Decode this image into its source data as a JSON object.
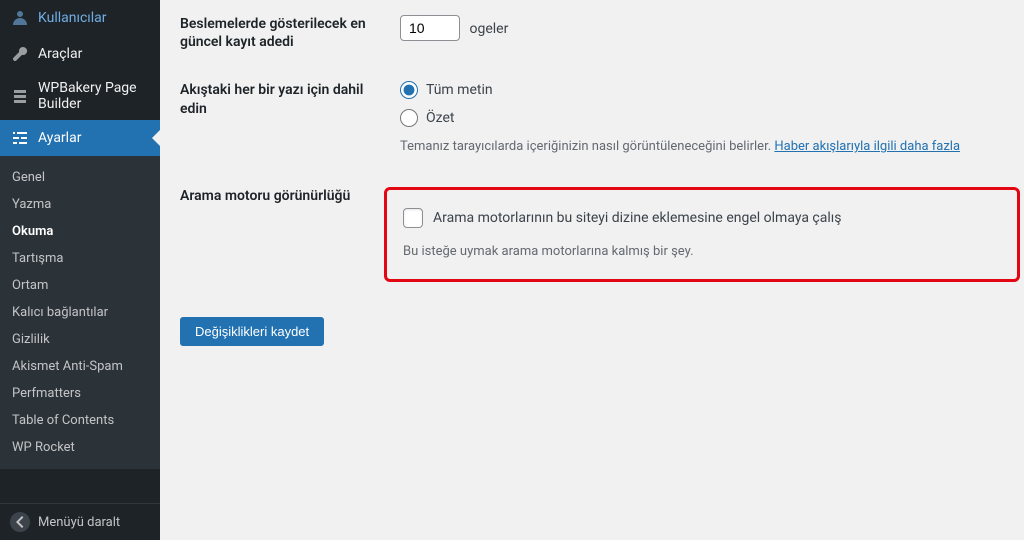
{
  "sidebar": {
    "top_items": [
      {
        "label": "Kullanıcılar"
      },
      {
        "label": "Araçlar"
      },
      {
        "label": "WPBakery Page Builder"
      },
      {
        "label": "Ayarlar"
      }
    ],
    "sub_items": [
      {
        "label": "Genel"
      },
      {
        "label": "Yazma"
      },
      {
        "label": "Okuma"
      },
      {
        "label": "Tartışma"
      },
      {
        "label": "Ortam"
      },
      {
        "label": "Kalıcı bağlantılar"
      },
      {
        "label": "Gizlilik"
      },
      {
        "label": "Akismet Anti-Spam"
      },
      {
        "label": "Perfmatters"
      },
      {
        "label": "Table of Contents"
      },
      {
        "label": "WP Rocket"
      }
    ],
    "collapse_label": "Menüyü daralt"
  },
  "form": {
    "feed_count": {
      "label": "Beslemelerde gösterilecek en güncel kayıt adedi",
      "value": "10",
      "suffix": "ogeler"
    },
    "feed_include": {
      "label": "Akıştaki her bir yazı için dahil edin",
      "opt_full": "Tüm metin",
      "opt_summary": "Özet",
      "desc_prefix": "Temanız tarayıcılarda içeriğinizin nasıl görüntüleneceğini belirler. ",
      "desc_link": "Haber akışlarıyla ilgili daha fazla"
    },
    "search_visibility": {
      "label": "Arama motoru görünürlüğü",
      "checkbox_label": "Arama motorlarının bu siteyi dizine eklemesine engel olmaya çalış",
      "desc": "Bu isteğe uymak arama motorlarına kalmış bir şey."
    },
    "save_button": "Değişiklikleri kaydet"
  }
}
